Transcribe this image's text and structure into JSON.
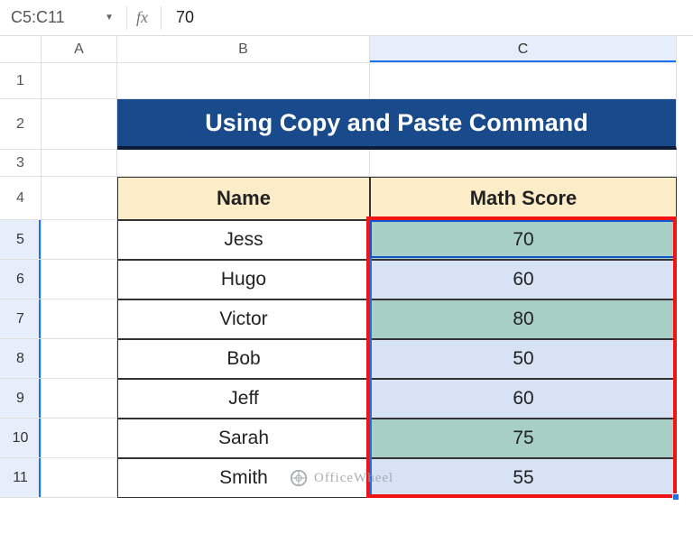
{
  "nameBox": "C5:C11",
  "formulaValue": "70",
  "columns": [
    "A",
    "B",
    "C"
  ],
  "rows": [
    "1",
    "2",
    "3",
    "4",
    "5",
    "6",
    "7",
    "8",
    "9",
    "10",
    "11"
  ],
  "title": "Using Copy and Paste Command",
  "headers": {
    "name": "Name",
    "score": "Math Score"
  },
  "data": [
    {
      "name": "Jess",
      "score": "70",
      "highlight": true
    },
    {
      "name": "Hugo",
      "score": "60",
      "highlight": false
    },
    {
      "name": "Victor",
      "score": "80",
      "highlight": true
    },
    {
      "name": "Bob",
      "score": "50",
      "highlight": false
    },
    {
      "name": "Jeff",
      "score": "60",
      "highlight": false
    },
    {
      "name": "Sarah",
      "score": "75",
      "highlight": true
    },
    {
      "name": "Smith",
      "score": "55",
      "highlight": false
    }
  ],
  "watermark": "OfficeWheel"
}
